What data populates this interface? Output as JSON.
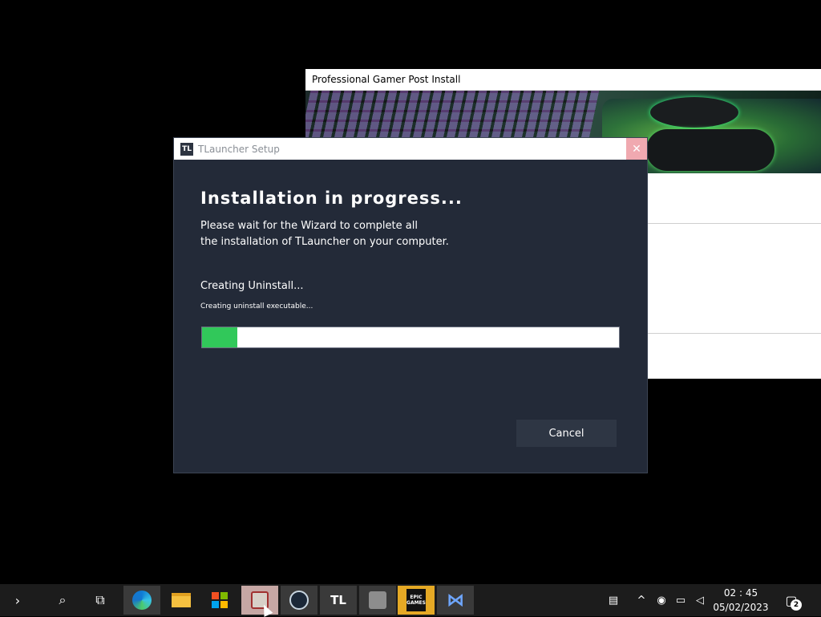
{
  "background_window": {
    "title": "Professional Gamer Post Install"
  },
  "dialog": {
    "title": "TLauncher Setup",
    "icon_text": "TL",
    "close_label": "✕",
    "heading": "Installation in progress...",
    "description_line1": "Please wait for the Wizard to complete all",
    "description_line2": "the installation of TLauncher on your computer.",
    "status": "Creating Uninstall...",
    "substatus": "Creating uninstall executable...",
    "progress_percent": 8.5,
    "cancel_label": "Cancel",
    "colors": {
      "background": "#232a38",
      "progress": "#31c85a"
    }
  },
  "taskbar": {
    "start_chevron": "›",
    "search_icon": "⌕",
    "task_view_icon": "⧉",
    "tl_label": "TL",
    "epic_label": "EPIC GAMES",
    "vs_label": "⋈",
    "tray_chevron": "^",
    "clock_time": "02 : 45",
    "clock_date": "05/02/2023",
    "notifications_count": "2"
  }
}
